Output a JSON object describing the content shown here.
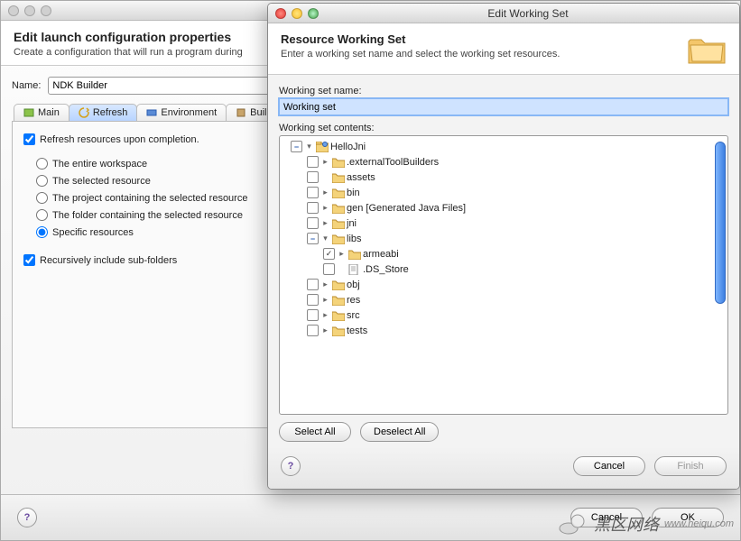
{
  "back": {
    "titlebar": "",
    "heading": "Edit launch configuration properties",
    "subheading": "Create a configuration that will run a program during",
    "name_label": "Name:",
    "name_value": "NDK Builder",
    "tabs": {
      "main": "Main",
      "refresh": "Refresh",
      "environment": "Environment",
      "build": "Build O"
    },
    "refresh_label": "Refresh resources upon completion.",
    "radios": {
      "workspace": "The entire workspace",
      "selected": "The selected resource",
      "project": "The project containing the selected resource",
      "folder": "The folder containing the selected resource",
      "specific": "Specific resources"
    },
    "recursive_label": "Recursively include sub-folders",
    "cancel": "Cancel",
    "ok": "OK"
  },
  "front": {
    "titlebar": "Edit Working Set",
    "heading": "Resource Working Set",
    "subheading": "Enter a working set name and select the working set resources.",
    "ws_name_label": "Working set name:",
    "ws_name_value": "Working set",
    "ws_contents_label": "Working set contents:",
    "tree": [
      {
        "depth": 0,
        "cb": "minus",
        "tw": "open",
        "icon": "project",
        "label": "HelloJni"
      },
      {
        "depth": 1,
        "cb": "empty",
        "tw": "closed",
        "icon": "folder",
        "label": ".externalToolBuilders"
      },
      {
        "depth": 1,
        "cb": "empty",
        "tw": "",
        "icon": "folder",
        "label": "assets"
      },
      {
        "depth": 1,
        "cb": "empty",
        "tw": "closed",
        "icon": "folder",
        "label": "bin"
      },
      {
        "depth": 1,
        "cb": "empty",
        "tw": "closed",
        "icon": "folder",
        "label": "gen [Generated Java Files]"
      },
      {
        "depth": 1,
        "cb": "empty",
        "tw": "closed",
        "icon": "folder",
        "label": "jni"
      },
      {
        "depth": 1,
        "cb": "minus",
        "tw": "open",
        "icon": "folder",
        "label": "libs"
      },
      {
        "depth": 2,
        "cb": "checked",
        "tw": "closed",
        "icon": "folder",
        "label": "armeabi"
      },
      {
        "depth": 2,
        "cb": "empty",
        "tw": "",
        "icon": "file",
        "label": ".DS_Store"
      },
      {
        "depth": 1,
        "cb": "empty",
        "tw": "closed",
        "icon": "folder",
        "label": "obj"
      },
      {
        "depth": 1,
        "cb": "empty",
        "tw": "closed",
        "icon": "folder",
        "label": "res"
      },
      {
        "depth": 1,
        "cb": "empty",
        "tw": "closed",
        "icon": "folder",
        "label": "src"
      },
      {
        "depth": 1,
        "cb": "empty",
        "tw": "closed",
        "icon": "folder",
        "label": "tests"
      }
    ],
    "select_all": "Select All",
    "deselect_all": "Deselect All",
    "cancel": "Cancel",
    "finish": "Finish"
  },
  "watermark": "黑区网络",
  "watermark_url": "www.heiqu.com"
}
